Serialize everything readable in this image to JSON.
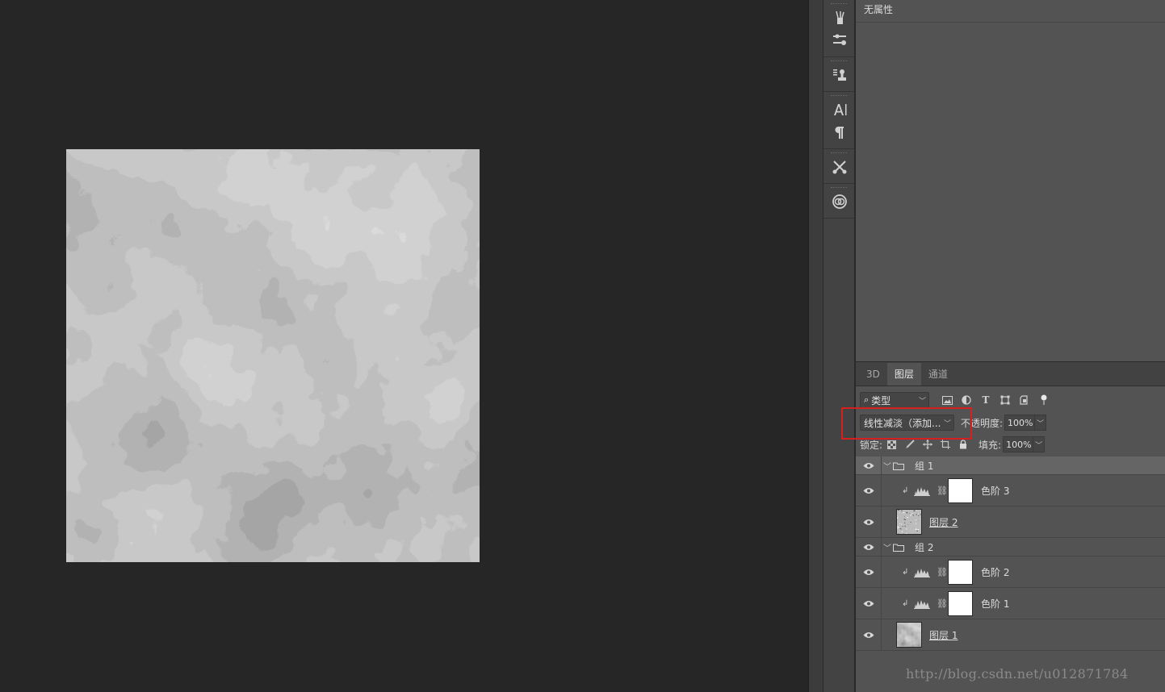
{
  "properties": {
    "title": "无属性"
  },
  "tabs": [
    {
      "label": "3D",
      "active": false
    },
    {
      "label": "图层",
      "active": true
    },
    {
      "label": "通道",
      "active": false
    }
  ],
  "filter": {
    "kind_label": "类型",
    "icons": [
      "image-filter-icon",
      "adjustment-filter-icon",
      "type-filter-icon",
      "shape-filter-icon",
      "smart-object-filter-icon",
      "filter-toggle-icon"
    ]
  },
  "blend": {
    "mode": "线性减淡（添加...",
    "opacity_label": "不透明度:",
    "opacity": "100%"
  },
  "lock": {
    "label": "锁定:",
    "fill_label": "填充:",
    "fill": "100%"
  },
  "layers": [
    {
      "type": "group",
      "name": "组 1",
      "expanded": true,
      "selected": true
    },
    {
      "type": "adjustment",
      "name": "色阶 3",
      "clipped": true
    },
    {
      "type": "pixel",
      "name": "图层 2",
      "thumb": "noise"
    },
    {
      "type": "group",
      "name": "组 2",
      "expanded": true,
      "selected": false
    },
    {
      "type": "adjustment",
      "name": "色阶 2",
      "clipped": true
    },
    {
      "type": "adjustment",
      "name": "色阶 1",
      "clipped": true
    },
    {
      "type": "pixel",
      "name": "图层 1",
      "thumb": "clouds"
    }
  ],
  "tools": [
    "brush-presets-icon",
    "tool-presets-icon",
    "clone-source-icon",
    "character-icon",
    "paragraph-icon",
    "brush-settings-icon",
    "creative-cloud-icon"
  ],
  "colors": {
    "highlight": "#d62020",
    "panel": "#535353",
    "canvas_bg": "#262626"
  },
  "watermark": "http://blog.csdn.net/u012871784"
}
